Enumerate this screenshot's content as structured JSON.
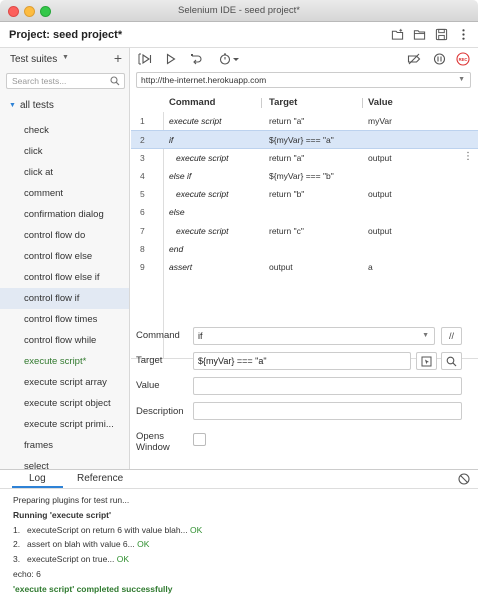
{
  "window": {
    "title": "Selenium IDE - seed project*"
  },
  "project": {
    "label": "Project:  seed project*"
  },
  "sidebar": {
    "suites_title": "Test suites",
    "add": "+",
    "search_placeholder": "Search tests...",
    "root": "all tests",
    "tests": [
      {
        "label": "check",
        "state": "normal"
      },
      {
        "label": "click",
        "state": "normal"
      },
      {
        "label": "click at",
        "state": "normal"
      },
      {
        "label": "comment",
        "state": "normal"
      },
      {
        "label": "confirmation dialog",
        "state": "normal"
      },
      {
        "label": "control flow do",
        "state": "normal"
      },
      {
        "label": "control flow else",
        "state": "normal"
      },
      {
        "label": "control flow else if",
        "state": "normal"
      },
      {
        "label": "control flow if",
        "state": "selected"
      },
      {
        "label": "control flow times",
        "state": "normal"
      },
      {
        "label": "control flow while",
        "state": "normal"
      },
      {
        "label": "execute script*",
        "state": "modified"
      },
      {
        "label": "execute script array",
        "state": "normal"
      },
      {
        "label": "execute script object",
        "state": "normal"
      },
      {
        "label": "execute script primi...",
        "state": "normal"
      },
      {
        "label": "frames",
        "state": "normal"
      },
      {
        "label": "select",
        "state": "normal"
      }
    ]
  },
  "toolbar": {
    "url": "http://the-internet.herokuapp.com",
    "rec_label": "REC"
  },
  "table": {
    "headers": {
      "command": "Command",
      "target": "Target",
      "value": "Value"
    },
    "rows": [
      {
        "num": "1",
        "command": "execute script",
        "target": "return \"a\"",
        "value": "myVar",
        "indent": 0
      },
      {
        "num": "2",
        "command": "if",
        "target": "${myVar} === \"a\"",
        "value": "",
        "indent": 0
      },
      {
        "num": "3",
        "command": "execute script",
        "target": "return \"a\"",
        "value": "output",
        "indent": 1
      },
      {
        "num": "4",
        "command": "else if",
        "target": "${myVar} === \"b\"",
        "value": "",
        "indent": 0
      },
      {
        "num": "5",
        "command": "execute script",
        "target": "return \"b\"",
        "value": "output",
        "indent": 1
      },
      {
        "num": "6",
        "command": "else",
        "target": "",
        "value": "",
        "indent": 0
      },
      {
        "num": "7",
        "command": "execute script",
        "target": "return \"c\"",
        "value": "output",
        "indent": 1
      },
      {
        "num": "8",
        "command": "end",
        "target": "",
        "value": "",
        "indent": 0
      },
      {
        "num": "9",
        "command": "assert",
        "target": "output",
        "value": "a",
        "indent": 0
      }
    ],
    "selected_row": 2
  },
  "editor": {
    "command_label": "Command",
    "command_value": "if",
    "comment_btn": "//",
    "target_label": "Target",
    "target_value": "${myVar} === \"a\"",
    "value_label": "Value",
    "value_value": "",
    "description_label": "Description",
    "description_value": "",
    "opens_label_1": "Opens",
    "opens_label_2": "Window"
  },
  "bottom": {
    "tab_log": "Log",
    "tab_reference": "Reference",
    "log": {
      "preparing": "Preparing plugins for test run...",
      "running": "Running 'execute script'",
      "step1_num": "1.",
      "step1_text": "executeScript on return 6 with value blah...",
      "step2_num": "2.",
      "step2_text": "assert on blah with value 6...",
      "step3_num": "3.",
      "step3_text": "executeScript on true...",
      "ok": "OK",
      "echo": "echo: 6",
      "completed": "'execute script' completed successfully"
    }
  }
}
